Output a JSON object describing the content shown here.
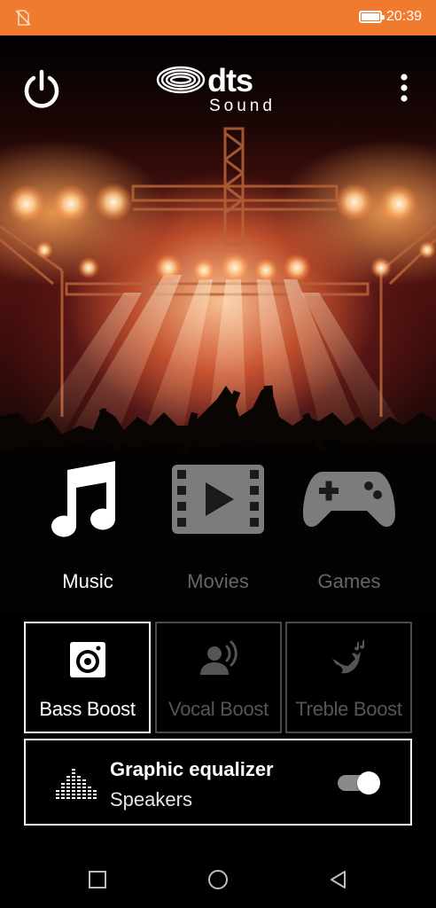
{
  "status_bar": {
    "time": "20:39",
    "left_icon": "no-sim-icon",
    "battery_icon": "battery-full-icon",
    "background": "#f07a2d"
  },
  "header": {
    "logo_brand": "dts",
    "logo_sub": "Sound",
    "power_icon": "power-icon",
    "menu_icon": "more-vert-icon"
  },
  "modes": [
    {
      "label": "Music",
      "icon": "music-note-icon",
      "selected": true
    },
    {
      "label": "Movies",
      "icon": "movie-film-icon",
      "selected": false
    },
    {
      "label": "Games",
      "icon": "gamepad-icon",
      "selected": false
    }
  ],
  "effects": [
    {
      "label": "Bass Boost",
      "icon": "speaker-icon",
      "selected": true
    },
    {
      "label": "Vocal Boost",
      "icon": "voice-icon",
      "selected": false
    },
    {
      "label": "Treble Boost",
      "icon": "bird-notes-icon",
      "selected": false
    }
  ],
  "equalizer": {
    "title": "Graphic equalizer",
    "subtitle": "Speakers",
    "icon": "equalizer-bars-icon",
    "enabled": true
  },
  "nav_bar": {
    "recents_icon": "square-icon",
    "home_icon": "circle-icon",
    "back_icon": "triangle-back-icon"
  },
  "colors": {
    "accent": "#f07a2d",
    "active_text": "#ffffff",
    "inactive_text": "#666666"
  }
}
